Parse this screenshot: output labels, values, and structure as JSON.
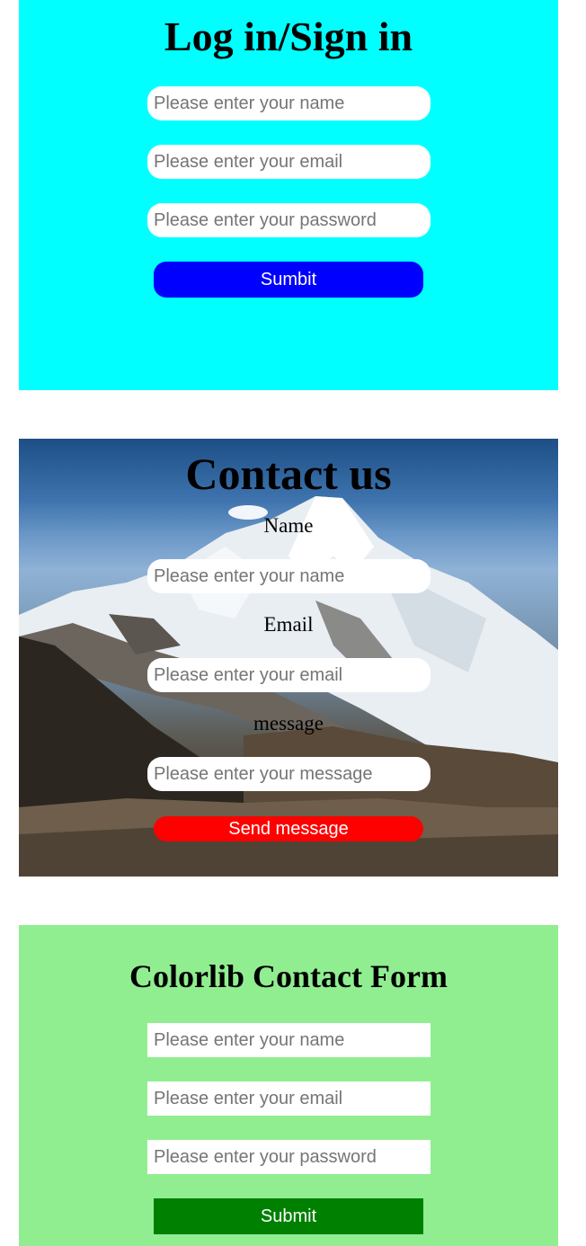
{
  "login": {
    "title": "Log in/Sign in",
    "name_placeholder": "Please enter your name",
    "email_placeholder": "Please enter your email",
    "password_placeholder": "Please enter your password",
    "submit_label": "Sumbit",
    "background": "#00ffff",
    "button_color": "#0000ff"
  },
  "contact": {
    "title": "Contact us",
    "name_label": "Name",
    "name_placeholder": "Please enter your name",
    "email_label": "Email",
    "email_placeholder": "Please enter your email",
    "message_label": "message",
    "message_placeholder": "Please enter your message",
    "send_label": "Send message",
    "button_color": "#ff0000",
    "background_image": "mountain-photo"
  },
  "colorlib": {
    "title": "Colorlib Contact Form",
    "name_placeholder": "Please enter your name",
    "email_placeholder": "Please enter your email",
    "password_placeholder": "Please enter your password",
    "submit_label": "Submit",
    "background": "#90ee90",
    "button_color": "#008000"
  }
}
